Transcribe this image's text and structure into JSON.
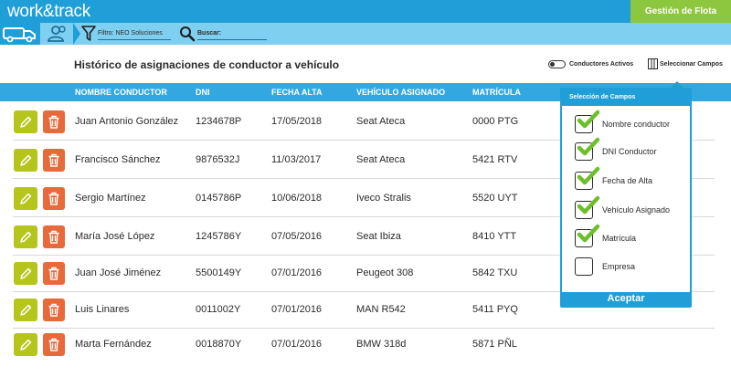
{
  "header": {
    "brand": "work&track",
    "gestion_label": "Gestión de Flota"
  },
  "toolbar": {
    "filter_label": "Filtro: NEO Soluciones",
    "search_label": "Buscar:"
  },
  "page": {
    "title": "Histórico de asignaciones de conductor a vehículo",
    "toggle_label": "Conductores Activos",
    "select_fields_label": "Seleccionar Campos"
  },
  "table": {
    "columns": [
      "NOMBRE CONDUCTOR",
      "DNI",
      "FECHA ALTA",
      "VEHÍCULO ASIGNADO",
      "MATRÍCULA"
    ],
    "rows": [
      [
        "Juan Antonio González",
        "1234678P",
        "17/05/2018",
        "Seat Ateca",
        "0000 PTG"
      ],
      [
        "Francisco Sánchez",
        "9876532J",
        "11/03/2017",
        "Seat Ateca",
        "5421 RTV"
      ],
      [
        "Sergio Martínez",
        "0145786P",
        "10/06/2018",
        "Iveco Stralis",
        "5520 UYT"
      ],
      [
        "María José López",
        "1245786Y",
        "07/05/2016",
        "Seat Ibiza",
        "8410 YTT"
      ],
      [
        "Juan José Jiménez",
        "5500149Y",
        "07/01/2016",
        "Peugeot 308",
        "5842 TXU"
      ],
      [
        "Luis Linares",
        "0011002Y",
        "07/01/2016",
        "MAN R542",
        "5411 PYQ"
      ],
      [
        "Marta Fernández",
        "0018870Y",
        "07/01/2016",
        "BMW 318d",
        "5871 PÑL"
      ]
    ]
  },
  "field_panel": {
    "title": "Selección de Campos",
    "options": [
      {
        "label": "Nombre conductor",
        "checked": true
      },
      {
        "label": "DNI Conductor",
        "checked": true
      },
      {
        "label": "Fecha de Alta",
        "checked": true
      },
      {
        "label": "Vehículo Asignado",
        "checked": true
      },
      {
        "label": "Matrícula",
        "checked": true
      },
      {
        "label": "Empresa",
        "checked": false
      }
    ],
    "accept_label": "Aceptar"
  },
  "colors": {
    "primary_blue": "#1f9ed8",
    "light_blue": "#7fd0f0",
    "green": "#8dc63f",
    "edit_button": "#b5c51c",
    "delete_button": "#e8693a",
    "check_green": "#6cbf2a"
  },
  "icons": {
    "toolbar": [
      "truck-icon",
      "user-group-icon",
      "filter-icon",
      "search-icon"
    ],
    "row_actions": [
      "pencil-icon",
      "trash-icon"
    ],
    "select_fields": "columns-icon"
  }
}
